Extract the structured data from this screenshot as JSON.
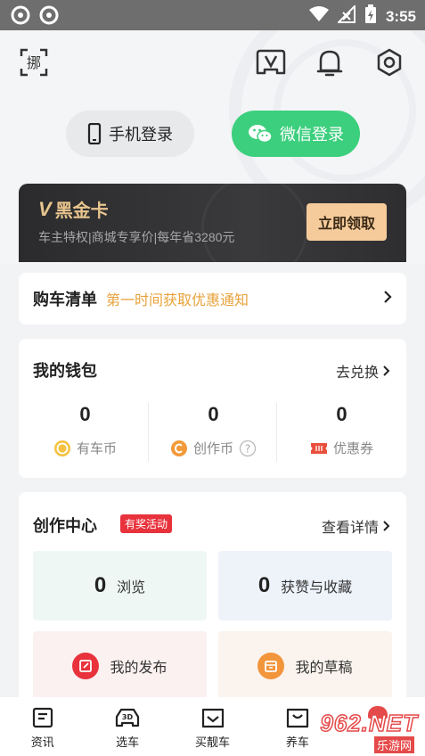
{
  "status_bar": {
    "time": "3:55"
  },
  "header": {
    "scan_label": "挪"
  },
  "login": {
    "phone_label": "手机登录",
    "wechat_label": "微信登录"
  },
  "vip_card": {
    "title": "黑金卡",
    "logo_char": "V",
    "description": "车主特权|商城专享价|每年省3280元",
    "button_label": "立即领取"
  },
  "car_list": {
    "title": "购车清单",
    "subtitle": "第一时间获取优惠通知"
  },
  "wallet": {
    "title": "我的钱包",
    "link_label": "去兑换",
    "items": [
      {
        "value": "0",
        "label": "有车币",
        "icon": "coin-icon"
      },
      {
        "value": "0",
        "label": "创作币",
        "icon": "creator-coin-icon"
      },
      {
        "value": "0",
        "label": "优惠券",
        "icon": "coupon-icon"
      }
    ]
  },
  "creation": {
    "title": "创作中心",
    "badge": "有奖活动",
    "link_label": "查看详情",
    "tiles": {
      "views_value": "0",
      "views_label": "浏览",
      "likes_value": "0",
      "likes_label": "获赞与收藏",
      "publish_label": "我的发布",
      "drafts_label": "我的草稿"
    }
  },
  "tabbar": {
    "items": [
      {
        "label": "资讯",
        "icon": "news-icon"
      },
      {
        "label": "选车",
        "icon": "car-3d-icon"
      },
      {
        "label": "买靓车",
        "icon": "shop-car-icon"
      },
      {
        "label": "养车",
        "icon": "car-care-icon"
      },
      {
        "label": "",
        "icon": "mine-icon"
      }
    ]
  },
  "watermark": {
    "text": "962.NET",
    "sub": "乐游网"
  },
  "colors": {
    "wechat_green": "#3ccf7d",
    "vip_gold": "#f6cb9b",
    "accent_orange": "#e8a23a",
    "badge_red": "#e8323c"
  }
}
